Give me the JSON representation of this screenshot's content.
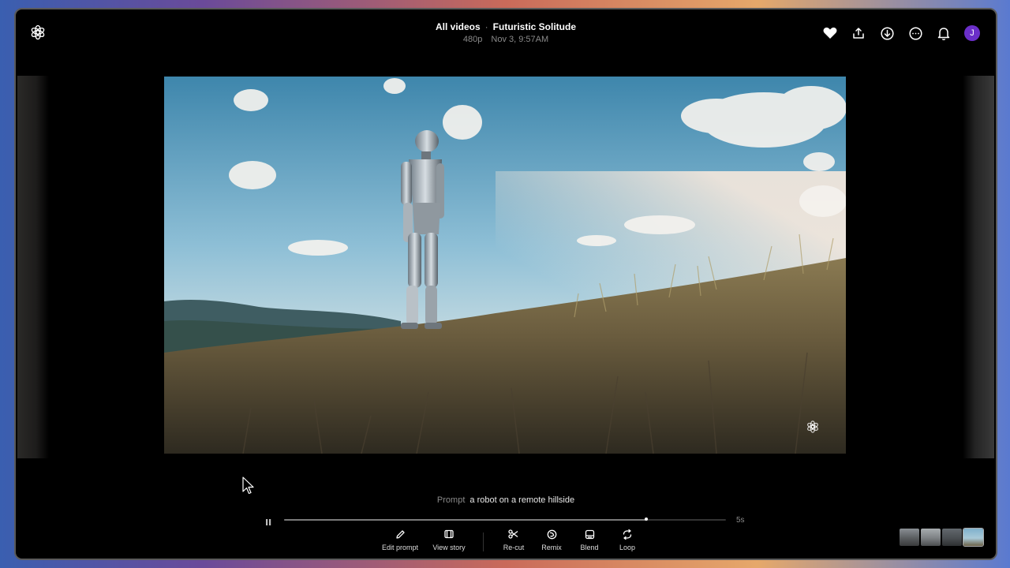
{
  "header": {
    "breadcrumb_all": "All videos",
    "separator": "·",
    "title": "Futuristic Solitude",
    "resolution": "480p",
    "timestamp": "Nov 3, 9:57AM"
  },
  "header_actions": [
    {
      "icon": "heart-icon"
    },
    {
      "icon": "share-icon"
    },
    {
      "icon": "download-icon"
    },
    {
      "icon": "more-icon"
    },
    {
      "icon": "bell-icon"
    }
  ],
  "user": {
    "initial": "J",
    "color": "#6b2fc9"
  },
  "prompt": {
    "label": "Prompt",
    "text": "a robot on a remote hillside"
  },
  "player": {
    "duration": "5s",
    "progress": 0.82,
    "state": "playing"
  },
  "toolbar": {
    "edit_prompt": "Edit prompt",
    "view_story": "View story",
    "recut": "Re-cut",
    "remix": "Remix",
    "blend": "Blend",
    "loop": "Loop"
  },
  "thumbnails": [
    {
      "selected": false
    },
    {
      "selected": false
    },
    {
      "selected": false
    },
    {
      "selected": true
    }
  ]
}
